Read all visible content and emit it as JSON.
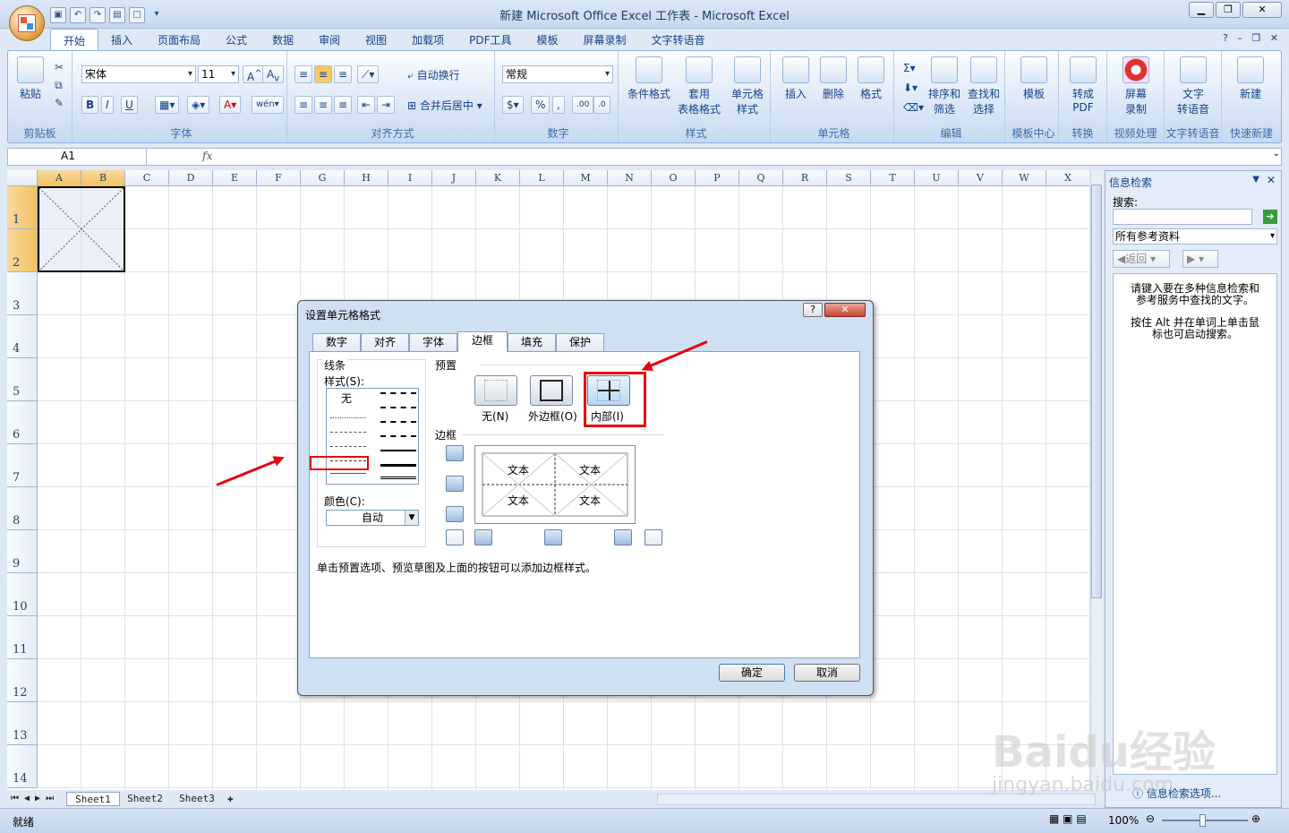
{
  "window": {
    "title": "新建 Microsoft Office Excel 工作表 - Microsoft Excel"
  },
  "ribbon": {
    "tabs": [
      "开始",
      "插入",
      "页面布局",
      "公式",
      "数据",
      "审阅",
      "视图",
      "加载项",
      "PDF工具",
      "模板",
      "屏幕录制",
      "文字转语音"
    ],
    "active_tab": "开始",
    "groups": {
      "clipboard": {
        "label": "剪贴板",
        "paste": "粘贴"
      },
      "font": {
        "label": "字体",
        "font_name": "宋体",
        "font_size": "11"
      },
      "alignment": {
        "label": "对齐方式",
        "wrap": "自动换行",
        "merge": "合并后居中"
      },
      "number": {
        "label": "数字",
        "format": "常规"
      },
      "styles": {
        "label": "样式",
        "cond": "条件格式",
        "table": "套用\n表格格式",
        "cell": "单元格\n样式"
      },
      "cells": {
        "label": "单元格",
        "insert": "插入",
        "delete": "删除",
        "format": "格式"
      },
      "editing": {
        "label": "编辑",
        "sort": "排序和\n筛选",
        "find": "查找和\n选择"
      },
      "template": {
        "label": "模板中心",
        "btn": "模板"
      },
      "convert": {
        "label": "转换",
        "btn": "转成\nPDF"
      },
      "video": {
        "label": "视频处理",
        "btn": "屏幕\n录制"
      },
      "tts": {
        "label": "文字转语音",
        "btn": "文字\n转语音"
      },
      "new": {
        "label": "快速新建",
        "btn": "新建"
      }
    }
  },
  "formula_bar": {
    "name_box": "A1",
    "fx": "fx"
  },
  "grid": {
    "columns": [
      "A",
      "B",
      "C",
      "D",
      "E",
      "F",
      "G",
      "H",
      "I",
      "J",
      "K",
      "L",
      "M",
      "N",
      "O",
      "P",
      "Q",
      "R",
      "S",
      "T",
      "U",
      "V",
      "W",
      "X"
    ],
    "rows": [
      "1",
      "2",
      "3",
      "4",
      "5",
      "6",
      "7",
      "8",
      "9",
      "10",
      "11",
      "12",
      "13",
      "14"
    ]
  },
  "sheets": [
    "Sheet1",
    "Sheet2",
    "Sheet3"
  ],
  "status": {
    "ready": "就绪",
    "zoom": "100%"
  },
  "task_pane": {
    "title": "信息检索",
    "search_label": "搜索:",
    "source": "所有参考资料",
    "back": "返回",
    "hint1": "请键入要在多种信息检索和参考服务中查找的文字。",
    "hint2": "按住 Alt 并在单词上单击鼠标也可启动搜索。",
    "footer": "信息检索选项..."
  },
  "dialog": {
    "title": "设置单元格格式",
    "tabs": [
      "数字",
      "对齐",
      "字体",
      "边框",
      "填充",
      "保护"
    ],
    "active_tab": "边框",
    "line_label": "线条",
    "style_label": "样式(S):",
    "none_style": "无",
    "color_label": "颜色(C):",
    "color_value": "自动",
    "preset_label": "预置",
    "presets": [
      "无(N)",
      "外边框(O)",
      "内部(I)"
    ],
    "border_label": "边框",
    "preview_text": "文本",
    "instruction": "单击预置选项、预览草图及上面的按钮可以添加边框样式。",
    "ok": "确定",
    "cancel": "取消"
  },
  "watermark": {
    "brand": "Baidu经验",
    "url": "jingyan.baidu.com"
  }
}
